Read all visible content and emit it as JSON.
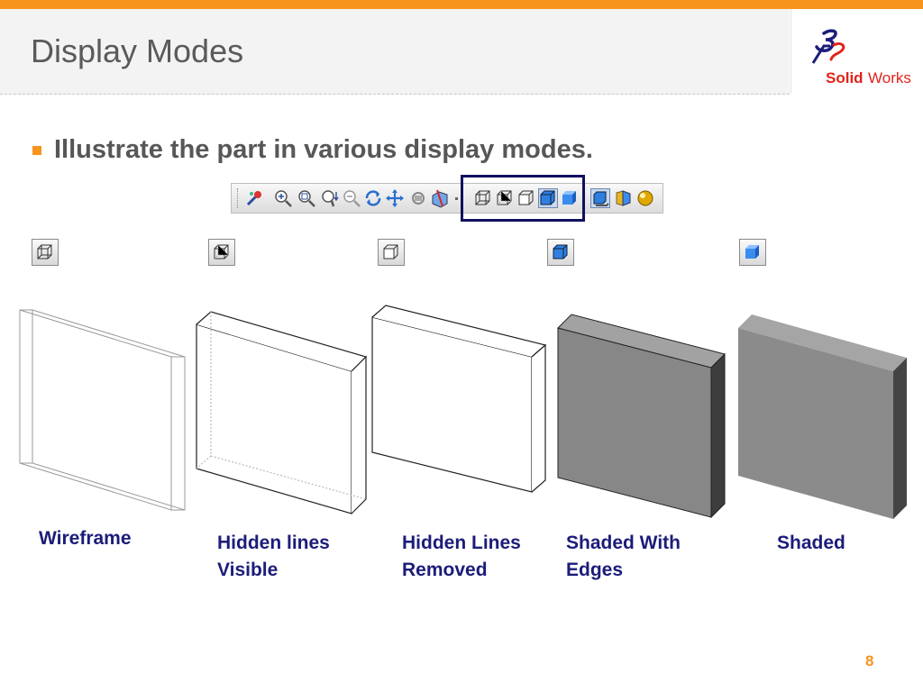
{
  "slide": {
    "title": "Display Modes",
    "bullet": "Illustrate the part in various display modes.",
    "page_number": "8"
  },
  "logo": {
    "brand_plain": "Solid",
    "brand_suffix": "Works",
    "mark": "3DS"
  },
  "colors": {
    "accent": "#f7941d",
    "label": "#1c1c7a",
    "title": "#5a5a5a",
    "selection_frame": "#101060"
  },
  "toolbar": {
    "buttons": [
      {
        "icon": "edit-appearance-icon"
      },
      {
        "icon": "zoom-to-fit-icon"
      },
      {
        "icon": "zoom-to-area-icon"
      },
      {
        "icon": "zoom-in-out-icon"
      },
      {
        "icon": "zoom-to-selection-icon"
      },
      {
        "icon": "rotate-view-icon"
      },
      {
        "icon": "pan-icon"
      },
      {
        "icon": "roll-view-icon"
      },
      {
        "icon": "section-view-icon"
      },
      {
        "icon": "wireframe-icon"
      },
      {
        "icon": "hidden-lines-visible-icon"
      },
      {
        "icon": "hidden-lines-removed-icon"
      },
      {
        "icon": "shaded-with-edges-icon"
      },
      {
        "icon": "shaded-icon"
      },
      {
        "icon": "shadows-icon"
      },
      {
        "icon": "perspective-icon"
      },
      {
        "icon": "realview-icon"
      }
    ]
  },
  "modes": [
    {
      "label": "Wireframe",
      "icon": "wireframe-icon"
    },
    {
      "label": "Hidden lines\nVisible",
      "icon": "hidden-lines-visible-icon"
    },
    {
      "label": "Hidden Lines\nRemoved",
      "icon": "hidden-lines-removed-icon"
    },
    {
      "label": "Shaded With\nEdges",
      "icon": "shaded-with-edges-icon"
    },
    {
      "label": "Shaded",
      "icon": "shaded-icon"
    }
  ]
}
